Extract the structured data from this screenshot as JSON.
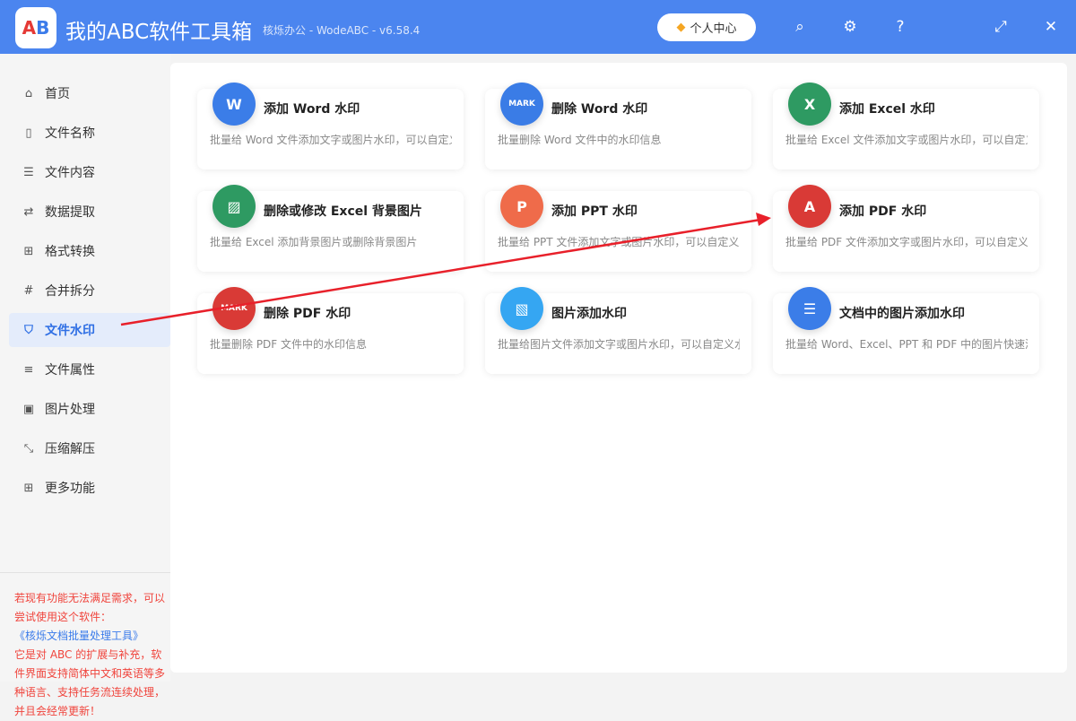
{
  "header": {
    "title": "我的ABC软件工具箱",
    "subtitle": "核烁办公 - WodeABC - v6.58.4",
    "personal_center": "个人中心"
  },
  "sidebar": {
    "items": [
      {
        "label": "首页",
        "icon": "home-icon",
        "glyph": "⌂"
      },
      {
        "label": "文件名称",
        "icon": "file-icon",
        "glyph": "▯"
      },
      {
        "label": "文件内容",
        "icon": "list-icon",
        "glyph": "☰"
      },
      {
        "label": "数据提取",
        "icon": "extract-icon",
        "glyph": "⇄"
      },
      {
        "label": "格式转换",
        "icon": "convert-icon",
        "glyph": "⊞"
      },
      {
        "label": "合并拆分",
        "icon": "hash-icon",
        "glyph": "#"
      },
      {
        "label": "文件水印",
        "icon": "shield-icon",
        "glyph": "⛉"
      },
      {
        "label": "文件属性",
        "icon": "properties-icon",
        "glyph": "≡"
      },
      {
        "label": "图片处理",
        "icon": "image-icon",
        "glyph": "▣"
      },
      {
        "label": "压缩解压",
        "icon": "compress-icon",
        "glyph": "⤡"
      },
      {
        "label": "更多功能",
        "icon": "grid-icon",
        "glyph": "⊞"
      }
    ],
    "active_index": 6,
    "note_1": "若现有功能无法满足需求，可以尝试使用这个软件：",
    "note_link": "《核烁文档批量处理工具》",
    "note_2": "它是对 ABC 的扩展与补充，软件界面支持简体中文和英语等多种语言、支持任务流连续处理，并且会经常更新！"
  },
  "cards": [
    {
      "title": "添加 Word 水印",
      "desc": "批量给 Word 文件添加文字或图片水印，可以自定义",
      "color": "#3b7de8",
      "glyph": "W"
    },
    {
      "title": "删除 Word 水印",
      "desc": "批量删除 Word 文件中的水印信息",
      "color": "#3a7ce6",
      "glyph": "MARK"
    },
    {
      "title": "添加 Excel 水印",
      "desc": "批量给 Excel 文件添加文字或图片水印，可以自定义",
      "color": "#2e9a62",
      "glyph": "X"
    },
    {
      "title": "删除或修改 Excel 背景图片",
      "desc": "批量给 Excel 添加背景图片或删除背景图片",
      "color": "#2e9a62",
      "glyph": "▨"
    },
    {
      "title": "添加 PPT 水印",
      "desc": "批量给 PPT 文件添加文字或图片水印，可以自定义水",
      "color": "#ef6b4a",
      "glyph": "P"
    },
    {
      "title": "添加 PDF 水印",
      "desc": "批量给 PDF 文件添加文字或图片水印，可以自定义水",
      "color": "#d93a36",
      "glyph": "A"
    },
    {
      "title": "删除 PDF 水印",
      "desc": "批量删除 PDF 文件中的水印信息",
      "color": "#d93a36",
      "glyph": "MARK"
    },
    {
      "title": "图片添加水印",
      "desc": "批量给图片文件添加文字或图片水印，可以自定义水",
      "color": "#35a6f2",
      "glyph": "▧"
    },
    {
      "title": "文档中的图片添加水印",
      "desc": "批量给 Word、Excel、PPT 和 PDF 中的图片快速添加",
      "color": "#3b7de8",
      "glyph": "☰"
    }
  ]
}
